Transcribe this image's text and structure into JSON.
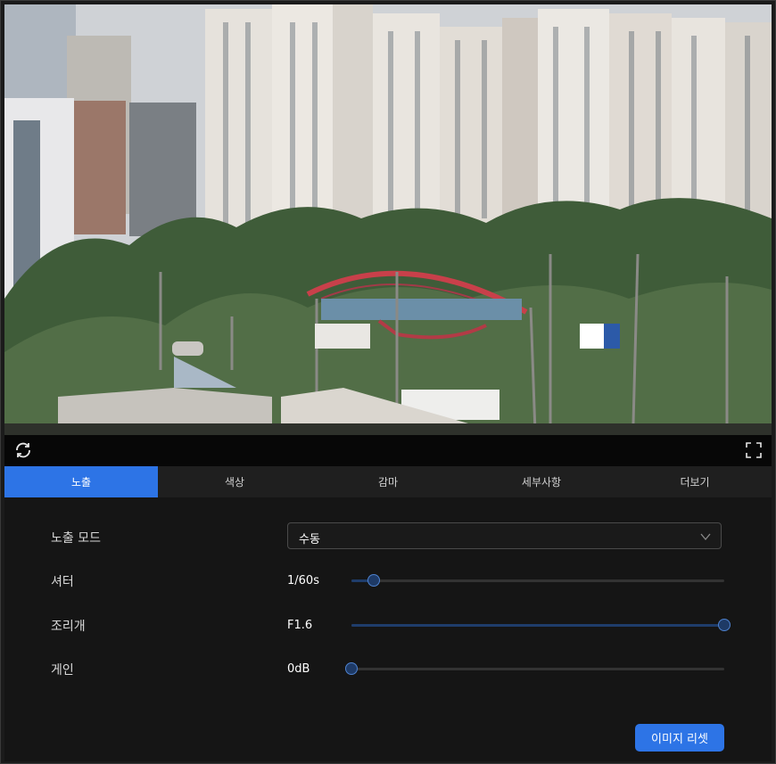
{
  "preview": {
    "description_icon": "camera-preview"
  },
  "toolbar": {
    "refresh_icon": "refresh-icon",
    "fullscreen_icon": "fullscreen-icon"
  },
  "tabs": [
    {
      "label": "노출",
      "active": true
    },
    {
      "label": "색상",
      "active": false
    },
    {
      "label": "감마",
      "active": false
    },
    {
      "label": "세부사항",
      "active": false
    },
    {
      "label": "더보기",
      "active": false
    }
  ],
  "exposure": {
    "mode_label": "노출 모드",
    "mode_value": "수동",
    "shutter_label": "셔터",
    "shutter_value": "1/60s",
    "shutter_level": 0.06,
    "iris_label": "조리개",
    "iris_value": "F1.6",
    "iris_level": 1.0,
    "gain_label": "게인",
    "gain_value": "0dB",
    "gain_level": 0.0
  },
  "actions": {
    "reset_label": "이미지 리셋"
  },
  "colors": {
    "accent": "#2d74e6",
    "slider_fill": "#1f3d6b"
  }
}
